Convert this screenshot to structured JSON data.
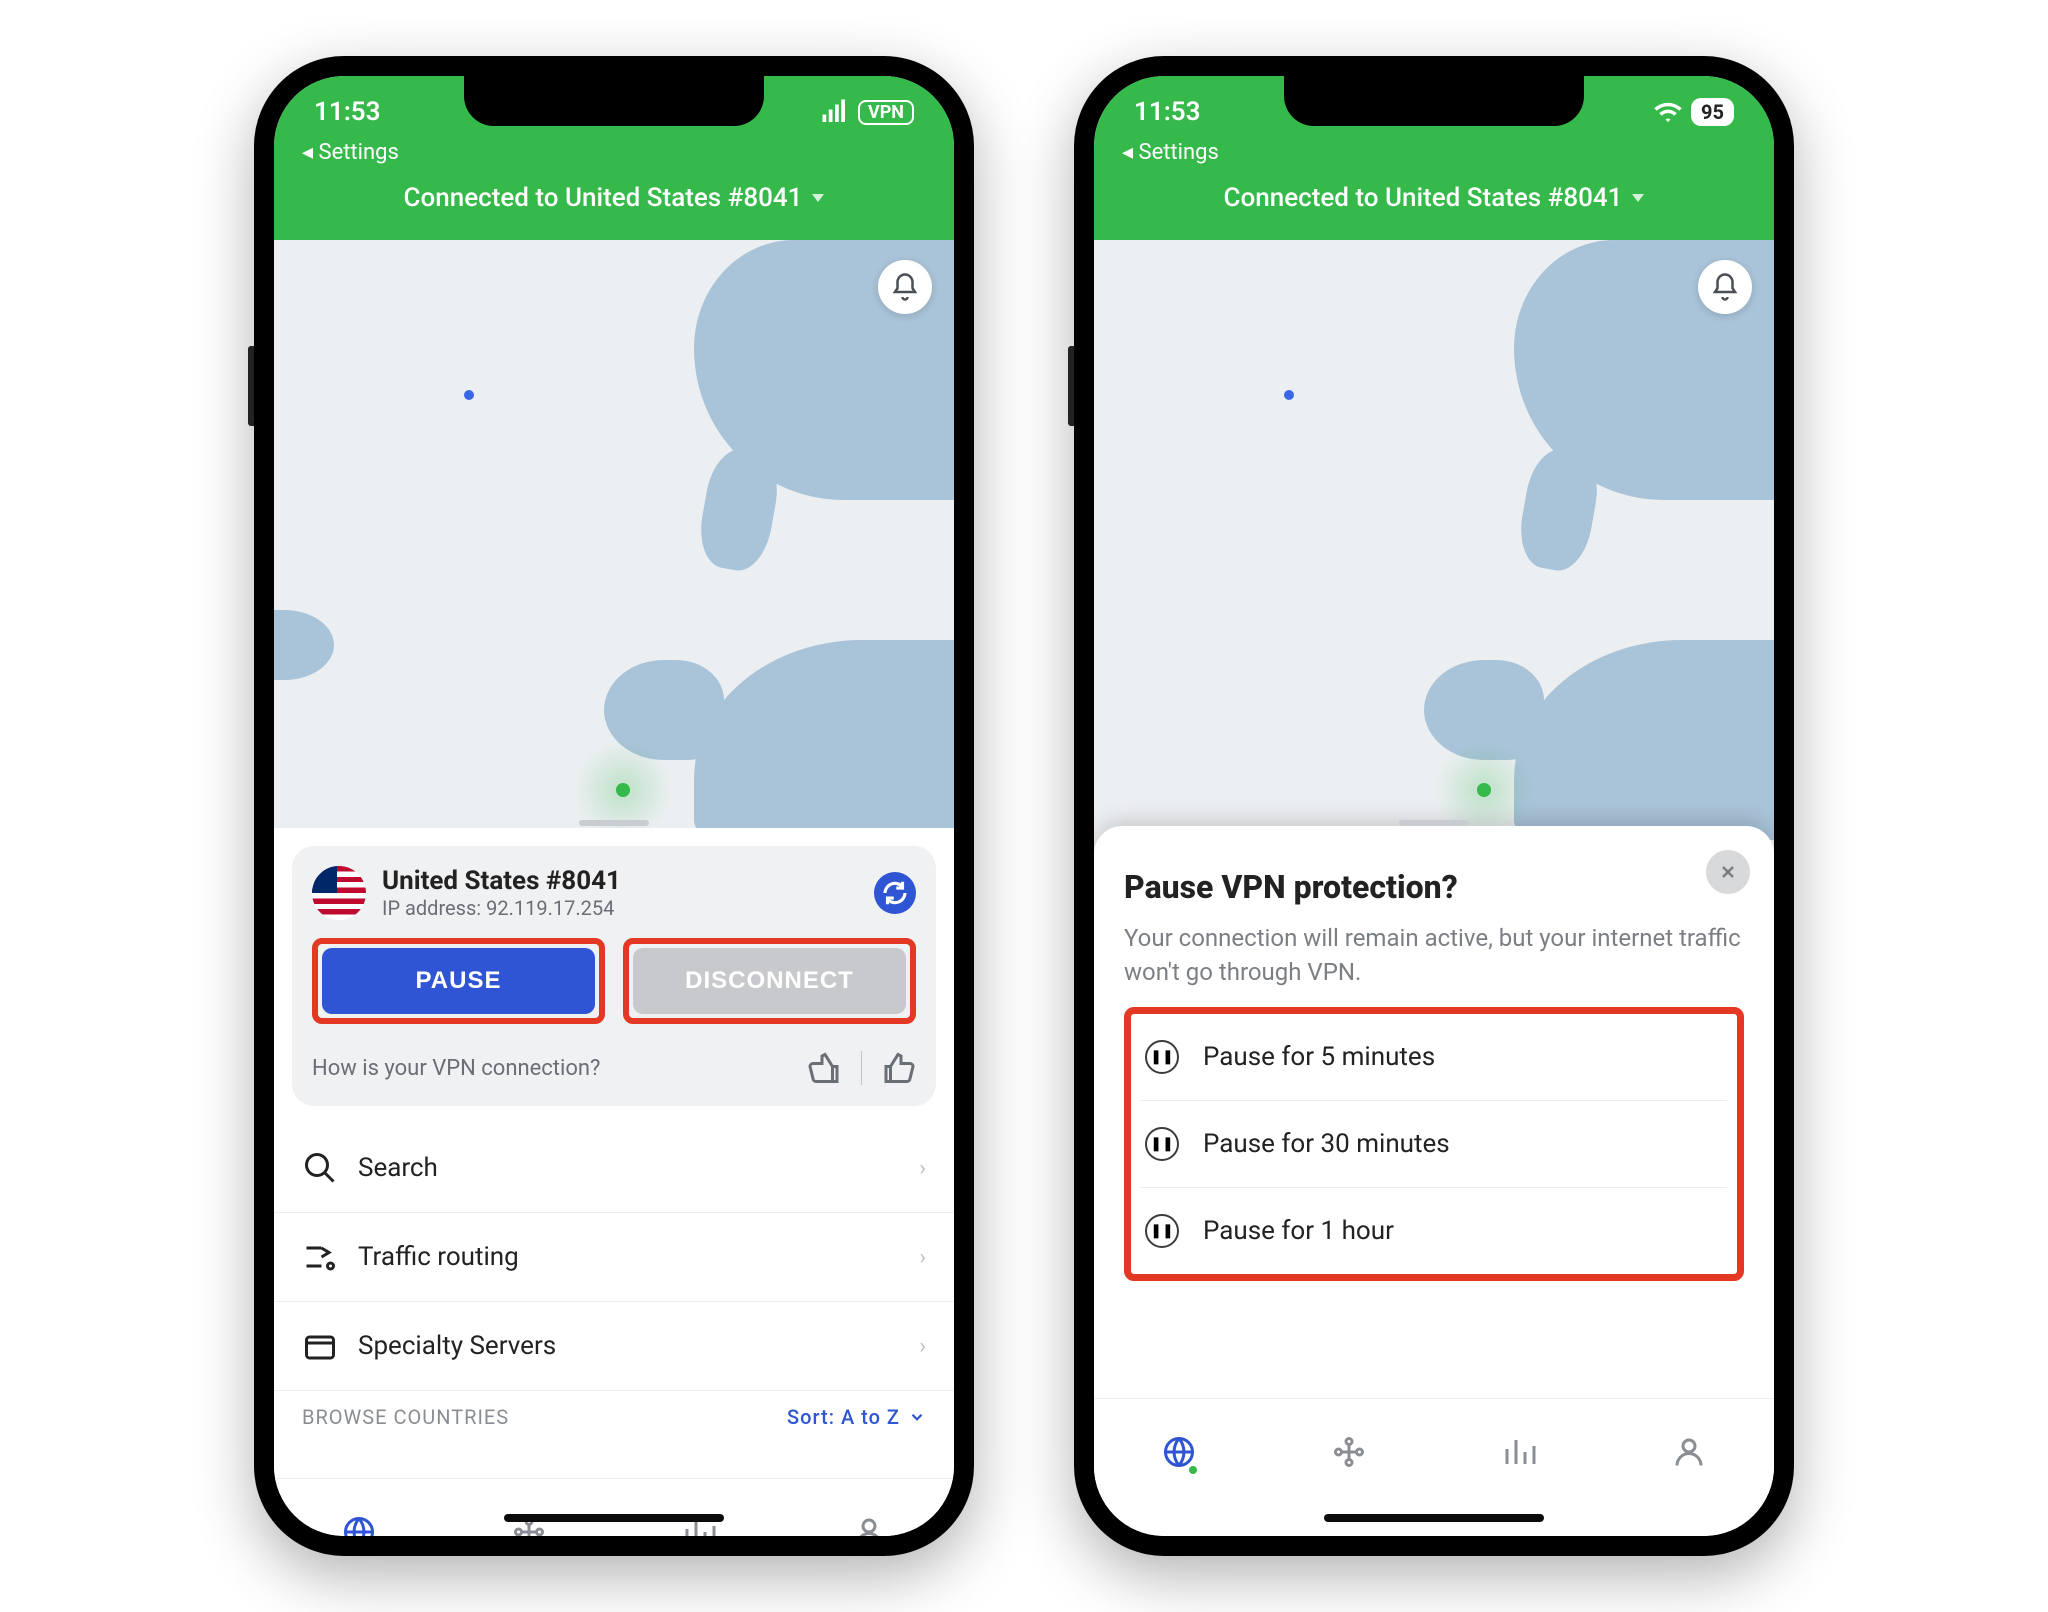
{
  "status": {
    "time": "11:53",
    "back_label": "Settings",
    "vpn_badge": "VPN",
    "battery": "95"
  },
  "header": {
    "connected_label": "Connected to United States #8041"
  },
  "server": {
    "name": "United States #8041",
    "ip_label": "IP address: 92.119.17.254"
  },
  "actions": {
    "pause": "PAUSE",
    "disconnect": "DISCONNECT"
  },
  "feedback": {
    "prompt": "How is your VPN connection?"
  },
  "menu": {
    "search": "Search",
    "routing": "Traffic routing",
    "specialty": "Specialty Servers"
  },
  "browse": {
    "label": "BROWSE COUNTRIES",
    "sort": "Sort: A to Z"
  },
  "sheet": {
    "title": "Pause VPN protection?",
    "desc": "Your connection will remain active, but your internet traffic won't go through VPN.",
    "opt1": "Pause for 5 minutes",
    "opt2": "Pause for 30 minutes",
    "opt3": "Pause for 1 hour"
  }
}
